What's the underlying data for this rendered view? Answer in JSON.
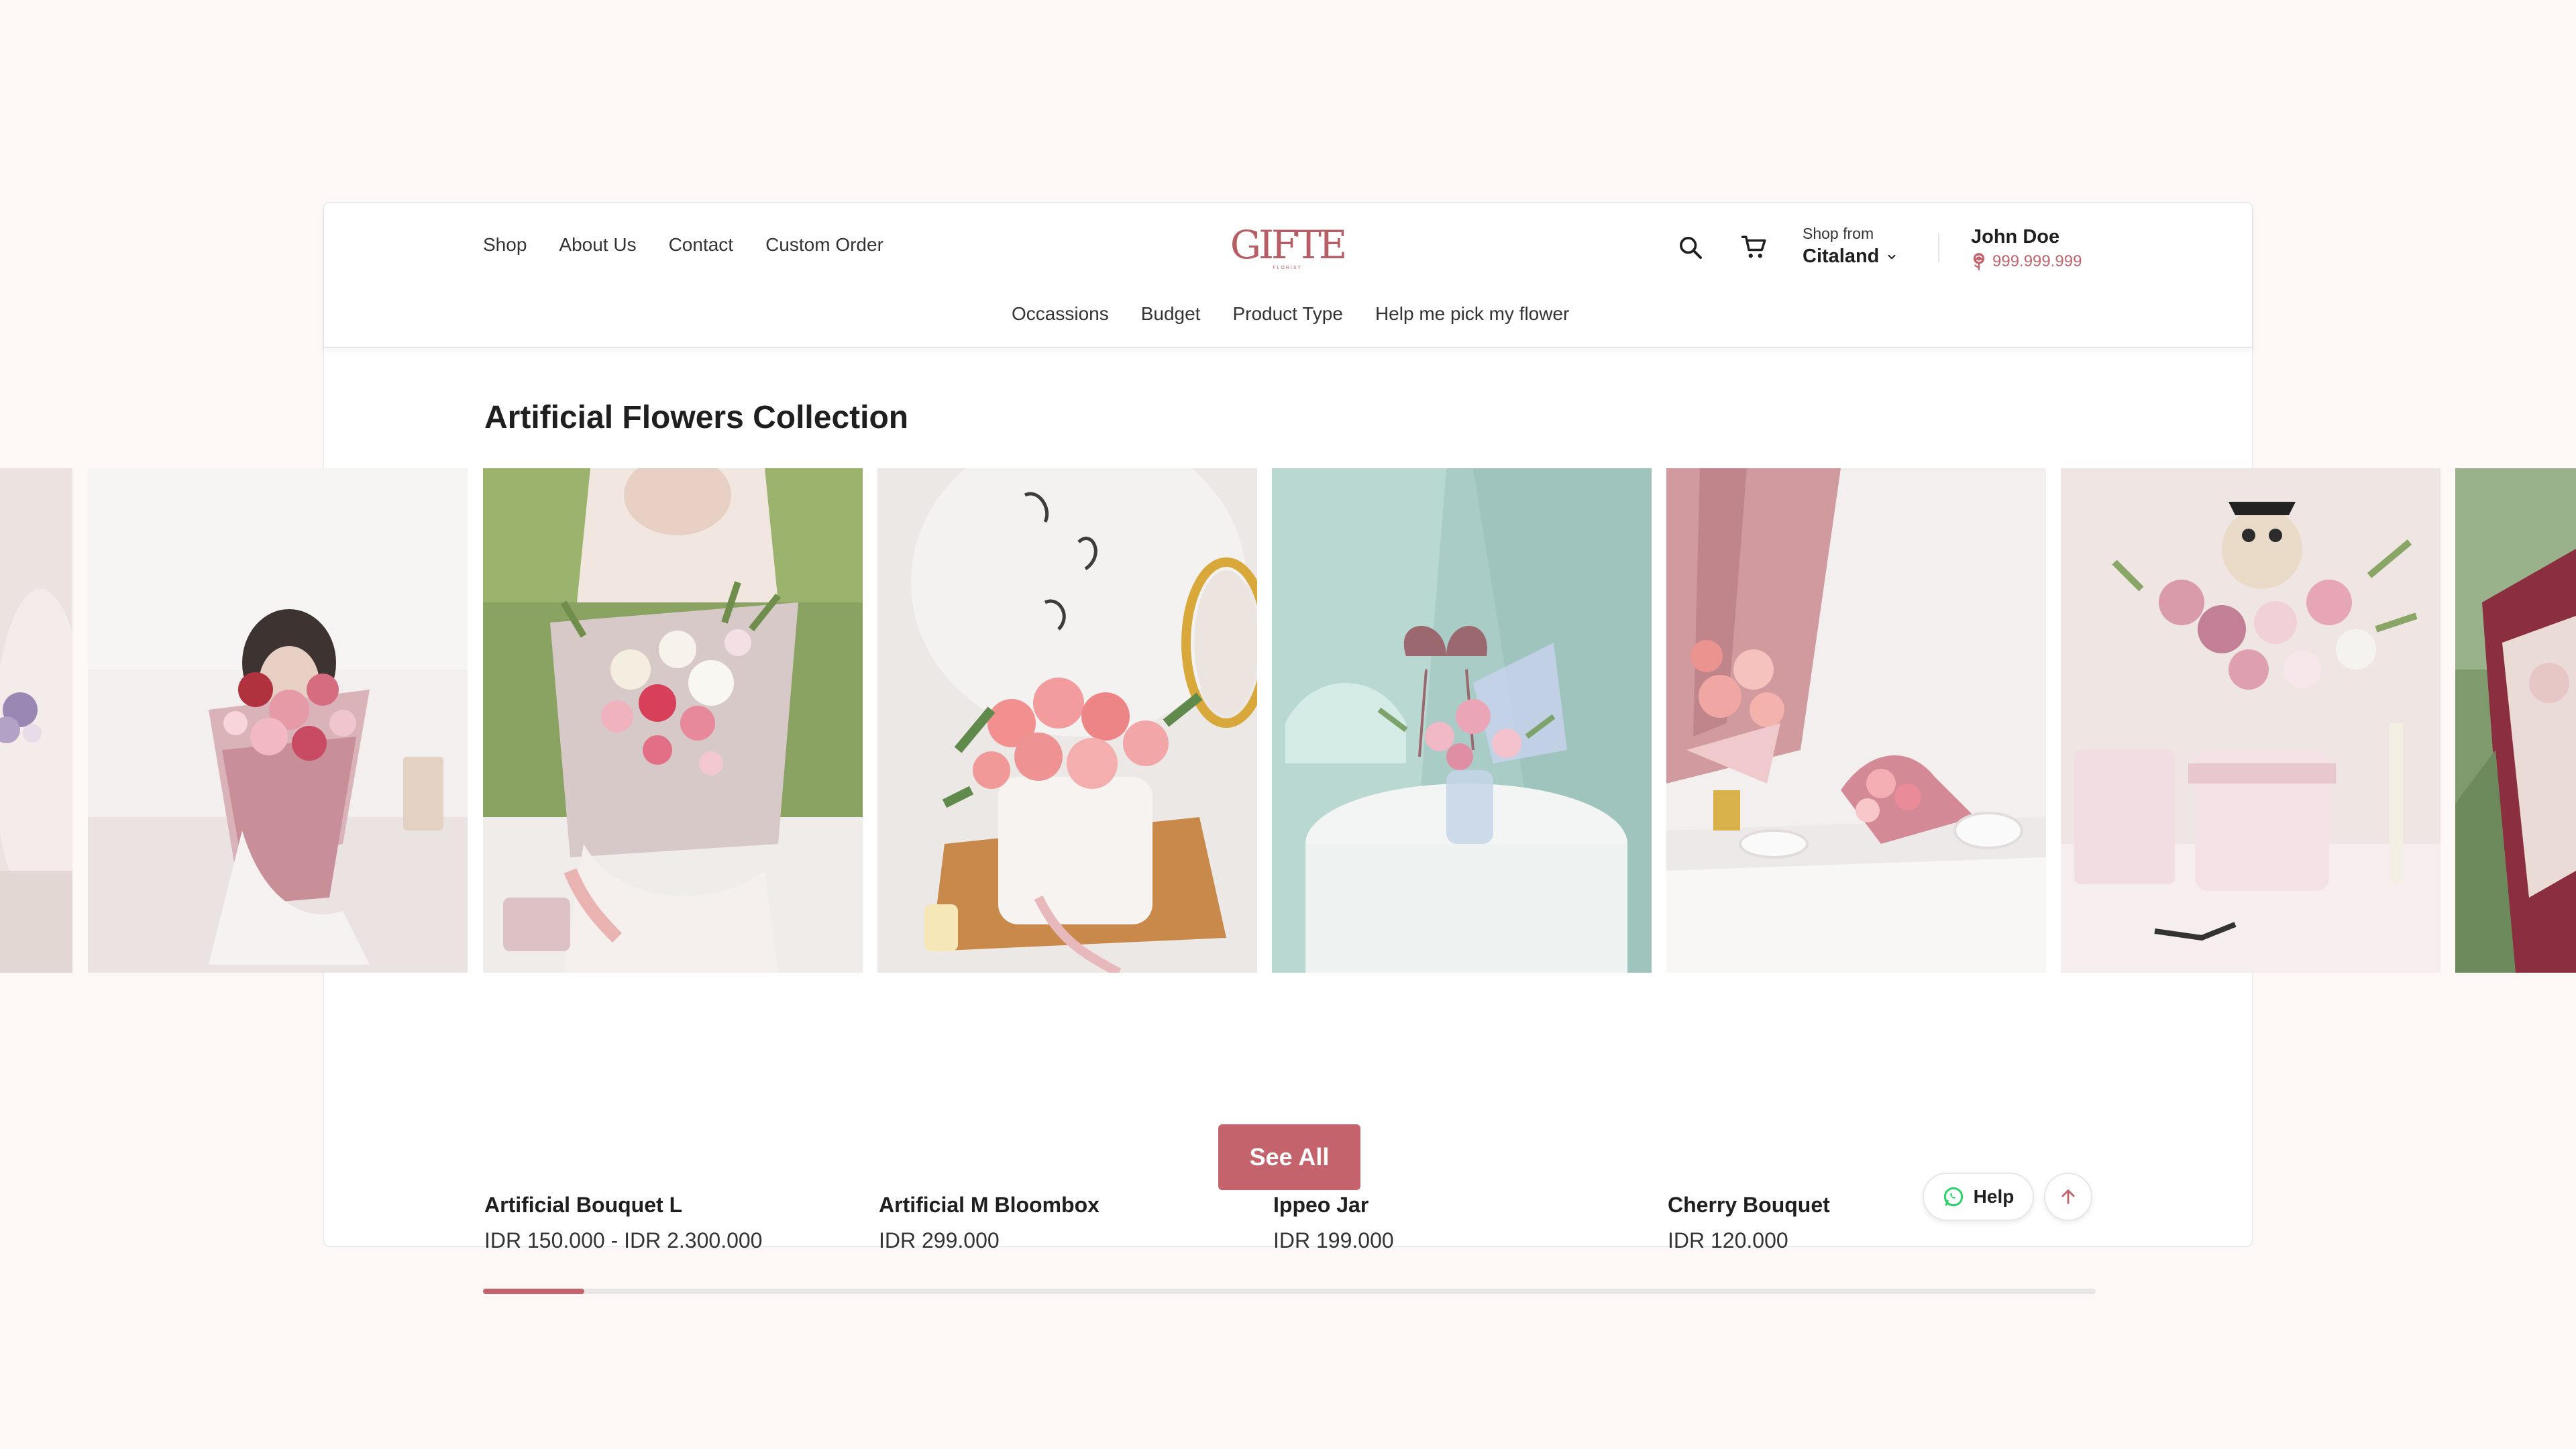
{
  "header": {
    "nav_main": [
      "Shop",
      "About Us",
      "Contact",
      "Custom Order"
    ],
    "logo_text": "GIFTE",
    "logo_sub": "FLORIST",
    "nav_sub": [
      "Occassions",
      "Budget",
      "Product Type",
      "Help me pick my flower"
    ],
    "shop_from_label": "Shop from",
    "shop_from_value": "Citaland",
    "user_name": "John Doe",
    "user_points": "999.999.999"
  },
  "section": {
    "title": "Artificial Flowers Collection"
  },
  "products": [
    {
      "name": "Artificial Bouquet L",
      "price": "IDR 150.000 - IDR 2.300.000"
    },
    {
      "name": "Artificial M Bloombox",
      "price": "IDR 299.000"
    },
    {
      "name": "Ippeo Jar",
      "price": "IDR 199.000"
    },
    {
      "name": "Cherry Bouquet",
      "price": "IDR 120.000"
    }
  ],
  "carousel": {
    "progress_fraction": 0.063
  },
  "actions": {
    "see_all_label": "See All",
    "help_label": "Help"
  },
  "colors": {
    "accent": "#c4636c",
    "background": "#fdf7f5",
    "whatsapp": "#25d366"
  },
  "icons": [
    "search-icon",
    "cart-icon",
    "chevron-down-icon",
    "rose-points-icon",
    "whatsapp-icon",
    "arrow-up-icon"
  ]
}
